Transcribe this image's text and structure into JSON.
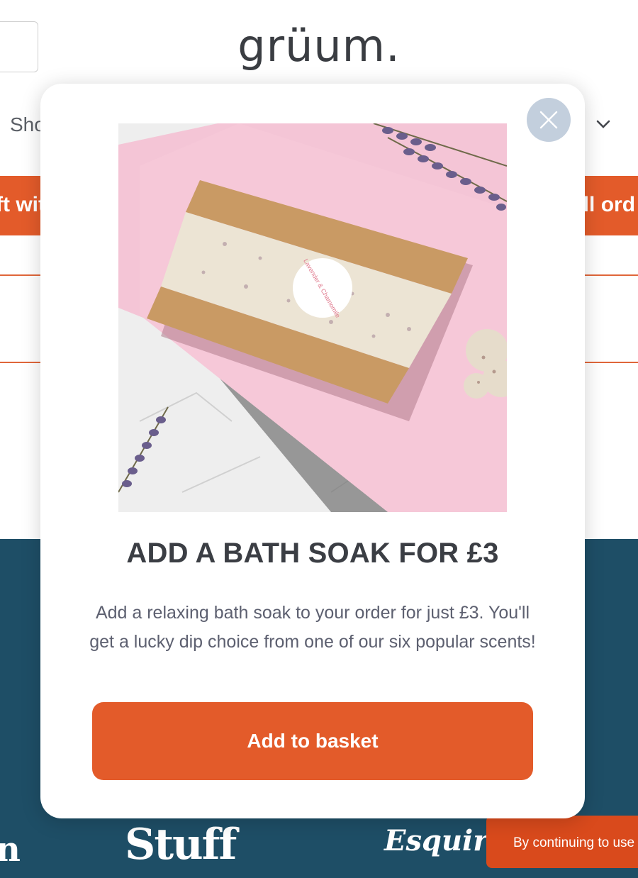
{
  "background": {
    "logo": "grüum.",
    "nav_partial": "Sho",
    "promo_left_partial": "ft wit",
    "promo_right_partial": "all ord",
    "press": {
      "partial_left": "n",
      "stuff": "Stuff",
      "esquire": "Esquire"
    },
    "cookie_banner": "By continuing to use"
  },
  "modal": {
    "title": "ADD A BATH SOAK FOR £3",
    "description": "Add a relaxing bath soak to your order for just £3. You'll get a lucky dip choice from one of our six popular scents!",
    "button_label": "Add to basket",
    "image_label": "Lavender & Chamomile",
    "close_icon": "close-icon"
  },
  "colors": {
    "accent": "#e35b2a",
    "band": "#1e4e66",
    "close_bg": "#c3cfdd",
    "title": "#3b3e44",
    "text": "#5d6070"
  }
}
